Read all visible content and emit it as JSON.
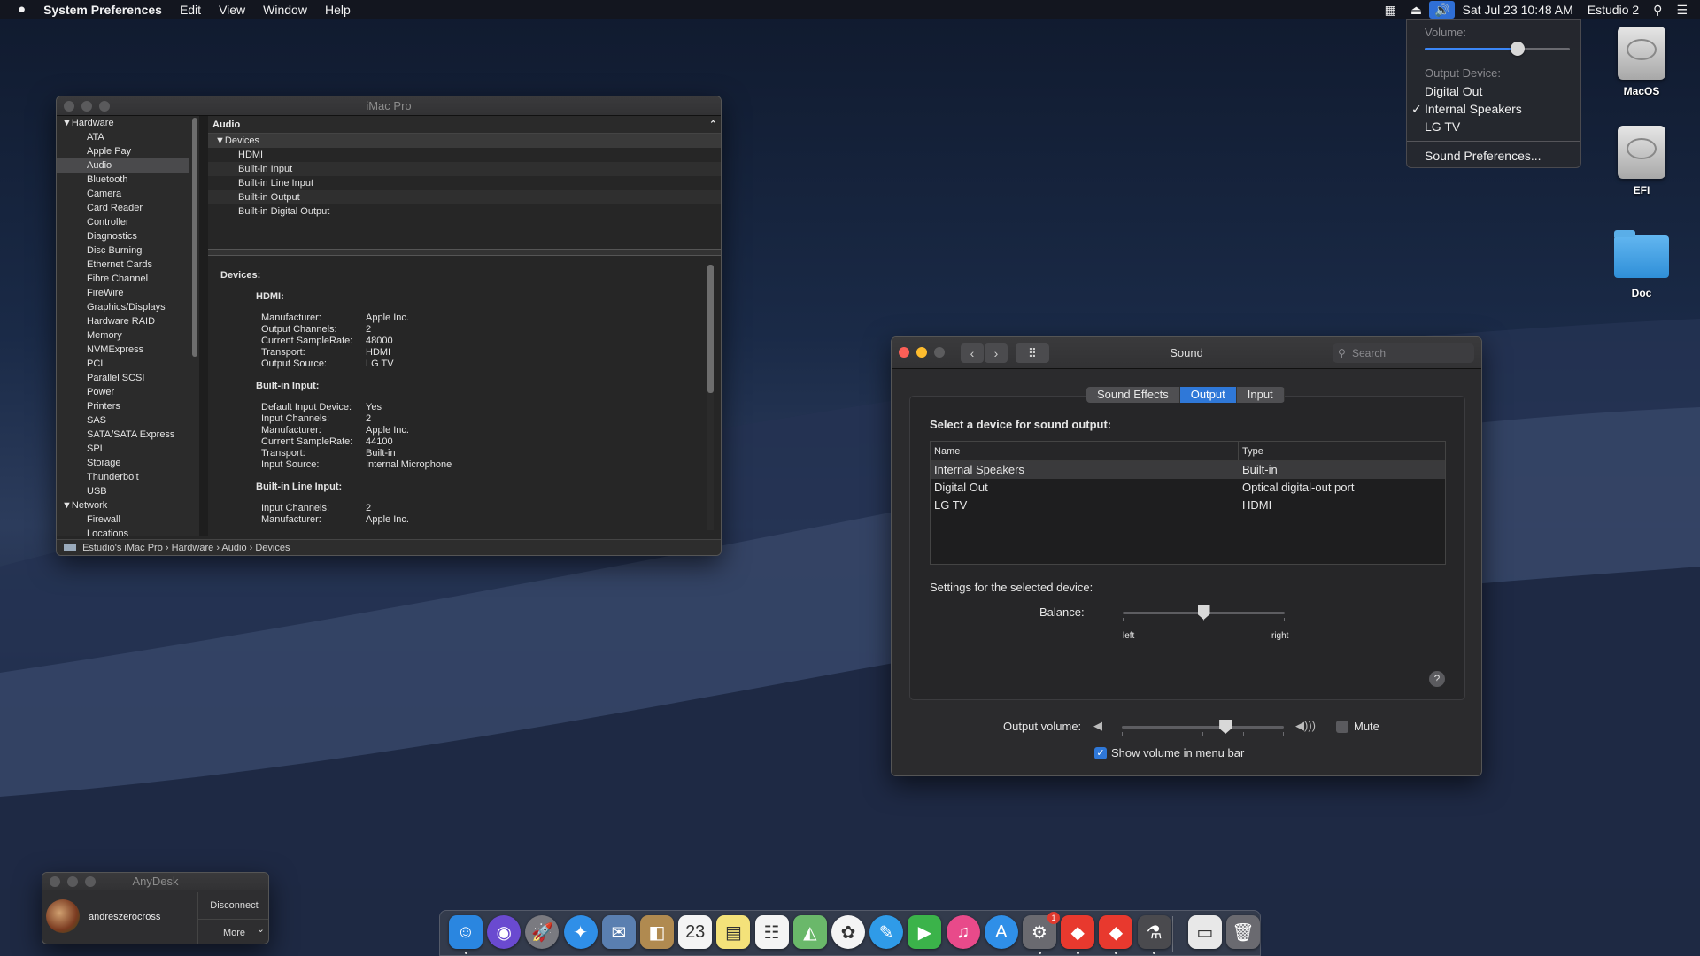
{
  "menubar": {
    "apple": "",
    "app": "System Preferences",
    "menus": [
      "Edit",
      "View",
      "Window",
      "Help"
    ],
    "date_time": "Sat Jul 23  10:48 AM",
    "user": "Estudio 2",
    "volume_icon": "🔊",
    "eject_icon": "⏏",
    "activity_icon": "▦",
    "search_icon": "⚲",
    "list_icon": "☰"
  },
  "volume_menu": {
    "volume_label": "Volume:",
    "volume_level": 0.64,
    "output_label": "Output Device:",
    "devices": [
      "Digital Out",
      "Internal Speakers",
      "LG TV"
    ],
    "checked_index": 1,
    "check": "✓",
    "prefs": "Sound Preferences..."
  },
  "desktop": {
    "icons": [
      {
        "label": "MacOS",
        "icon": "hard-disk"
      },
      {
        "label": "EFI",
        "icon": "hard-disk"
      },
      {
        "label": "Doc",
        "icon": "folder"
      }
    ]
  },
  "sysinfo": {
    "title": "iMac Pro",
    "sidebar": [
      {
        "label": "▼Hardware",
        "cat": true
      },
      {
        "label": "ATA"
      },
      {
        "label": "Apple Pay"
      },
      {
        "label": "Audio",
        "selected": true
      },
      {
        "label": "Bluetooth"
      },
      {
        "label": "Camera"
      },
      {
        "label": "Card Reader"
      },
      {
        "label": "Controller"
      },
      {
        "label": "Diagnostics"
      },
      {
        "label": "Disc Burning"
      },
      {
        "label": "Ethernet Cards"
      },
      {
        "label": "Fibre Channel"
      },
      {
        "label": "FireWire"
      },
      {
        "label": "Graphics/Displays"
      },
      {
        "label": "Hardware RAID"
      },
      {
        "label": "Memory"
      },
      {
        "label": "NVMExpress"
      },
      {
        "label": "PCI"
      },
      {
        "label": "Parallel SCSI"
      },
      {
        "label": "Power"
      },
      {
        "label": "Printers"
      },
      {
        "label": "SAS"
      },
      {
        "label": "SATA/SATA Express"
      },
      {
        "label": "SPI"
      },
      {
        "label": "Storage"
      },
      {
        "label": "Thunderbolt"
      },
      {
        "label": "USB"
      },
      {
        "label": "▼Network",
        "cat": true
      },
      {
        "label": "Firewall"
      },
      {
        "label": "Locations"
      }
    ],
    "column_header": "Audio",
    "collapse_icon": "⌃",
    "tree_root": "▼Devices",
    "tree_items": [
      "HDMI",
      "Built-in Input",
      "Built-in Line Input",
      "Built-in Output",
      "Built-in Digital Output"
    ],
    "detail": {
      "heading": "Devices:",
      "sections": [
        {
          "name": "HDMI:",
          "rows": [
            [
              "Manufacturer:",
              "Apple Inc."
            ],
            [
              "Output Channels:",
              "2"
            ],
            [
              "Current SampleRate:",
              "48000"
            ],
            [
              "Transport:",
              "HDMI"
            ],
            [
              "Output Source:",
              "LG TV"
            ]
          ]
        },
        {
          "name": "Built-in Input:",
          "rows": [
            [
              "Default Input Device:",
              "Yes"
            ],
            [
              "Input Channels:",
              "2"
            ],
            [
              "Manufacturer:",
              "Apple Inc."
            ],
            [
              "Current SampleRate:",
              "44100"
            ],
            [
              "Transport:",
              "Built-in"
            ],
            [
              "Input Source:",
              "Internal Microphone"
            ]
          ]
        },
        {
          "name": "Built-in Line Input:",
          "rows": [
            [
              "Input Channels:",
              "2"
            ],
            [
              "Manufacturer:",
              "Apple Inc."
            ]
          ]
        }
      ]
    },
    "pathbar": "Estudio's iMac Pro  ›  Hardware  ›  Audio  ›  Devices"
  },
  "sound": {
    "title": "Sound",
    "back": "‹",
    "forward": "›",
    "grid": "⠿",
    "search_placeholder": "Search",
    "tabs": [
      "Sound Effects",
      "Output",
      "Input"
    ],
    "active_tab": 1,
    "select_label": "Select a device for sound output:",
    "columns": [
      "Name",
      "Type"
    ],
    "devices": [
      {
        "name": "Internal Speakers",
        "type": "Built-in",
        "selected": true
      },
      {
        "name": "Digital Out",
        "type": "Optical digital-out port"
      },
      {
        "name": "LG TV",
        "type": "HDMI"
      }
    ],
    "settings_label": "Settings for the selected device:",
    "balance_label": "Balance:",
    "balance_value": 0.5,
    "left": "left",
    "right": "right",
    "help": "?",
    "output_volume_label": "Output volume:",
    "output_volume": 0.64,
    "vol_low_icon": "◀",
    "vol_high_icon": "◀)))",
    "mute_label": "Mute",
    "mute_checked": false,
    "show_volume_label": "Show volume in menu bar",
    "show_volume_checked": true,
    "check": "✓"
  },
  "anydesk": {
    "title": "AnyDesk",
    "user": "andreszerocross",
    "disconnect": "Disconnect",
    "more": "More",
    "chevron": "⌄"
  },
  "dock": {
    "items": [
      {
        "name": "finder",
        "glyph": "☺",
        "color": "#2a86e0",
        "running": true
      },
      {
        "name": "siri",
        "glyph": "◉",
        "color": "#6a4ad0",
        "round": true
      },
      {
        "name": "launchpad",
        "glyph": "🚀",
        "color": "#7a7a80",
        "round": true
      },
      {
        "name": "safari",
        "glyph": "✦",
        "color": "#2f8fe8",
        "round": true
      },
      {
        "name": "mail",
        "glyph": "✉",
        "color": "#5a7fb0"
      },
      {
        "name": "contacts",
        "glyph": "◧",
        "color": "#b08a50"
      },
      {
        "name": "calendar",
        "glyph": "23",
        "color": "#f4f4f4"
      },
      {
        "name": "notes",
        "glyph": "▤",
        "color": "#f4e27a"
      },
      {
        "name": "reminders",
        "glyph": "☷",
        "color": "#f4f4f4"
      },
      {
        "name": "maps",
        "glyph": "◭",
        "color": "#6ab86a"
      },
      {
        "name": "photos",
        "glyph": "✿",
        "color": "#f4f4f4",
        "round": true
      },
      {
        "name": "messages",
        "glyph": "✎",
        "color": "#2f9be8",
        "round": true
      },
      {
        "name": "facetime",
        "glyph": "▶",
        "color": "#3bb34a"
      },
      {
        "name": "itunes",
        "glyph": "♫",
        "color": "#e84a8a",
        "round": true
      },
      {
        "name": "app-store",
        "glyph": "A",
        "color": "#2f8fe8",
        "round": true
      },
      {
        "name": "system-preferences",
        "glyph": "⚙",
        "color": "#6a6a70",
        "running": true,
        "badge": "1"
      },
      {
        "name": "anydesk",
        "glyph": "◆",
        "color": "#e8392e",
        "running": true
      },
      {
        "name": "anydesk-2",
        "glyph": "◆",
        "color": "#e8392e",
        "running": true
      },
      {
        "name": "system-information",
        "glyph": "⚗",
        "color": "#4a4a4e",
        "running": true
      },
      {
        "name": "document",
        "glyph": "▭",
        "color": "#e8e8e8"
      },
      {
        "name": "trash",
        "glyph": "🗑",
        "color": "#6a6a70"
      }
    ]
  }
}
